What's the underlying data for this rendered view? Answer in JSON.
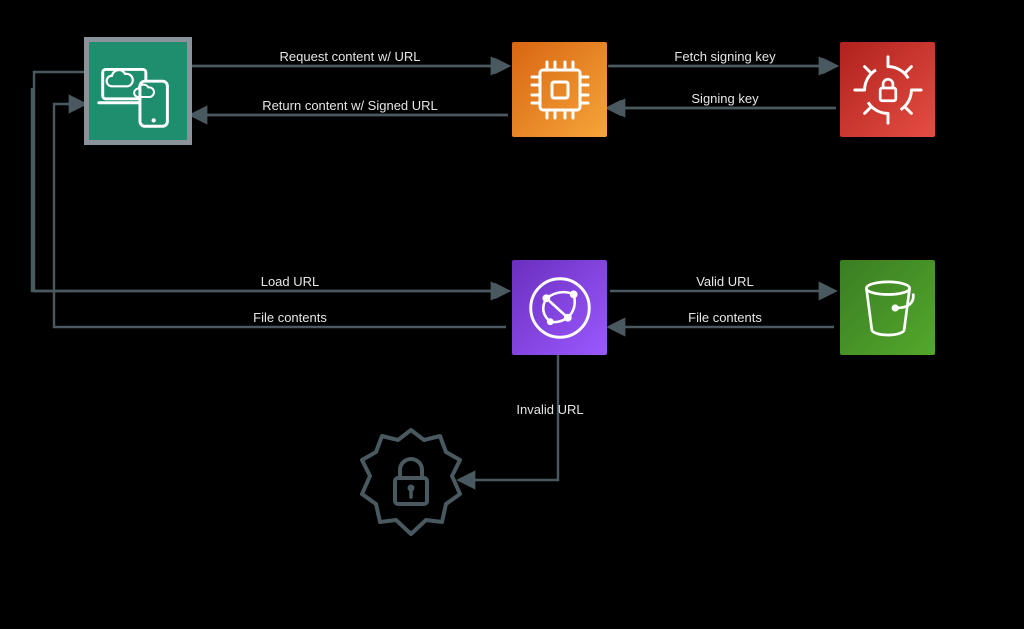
{
  "diagram": {
    "labels": {
      "top_req": "Request content w/ URL",
      "top_ret": "Return content w/ Signed URL",
      "fetch_key": "Fetch signing key",
      "signing_key": "Signing key",
      "load_url": "Load URL",
      "file_contents_left": "File contents",
      "valid_url": "Valid URL",
      "file_contents_right": "File contents",
      "invalid_url": "Invalid URL"
    },
    "nodes": {
      "client": "client-devices-icon",
      "compute": "compute-chip-icon",
      "secrets": "secrets-manager-icon",
      "cloudfront": "cloudfront-icon",
      "s3": "s3-bucket-icon",
      "shield": "access-denied-shield-icon"
    },
    "colors": {
      "client": "#1e8e6e",
      "compute_a": "#d86613",
      "compute_b": "#f6a539",
      "secrets_a": "#b0221e",
      "secrets_b": "#e54d42",
      "cloudfront_a": "#6b2fbf",
      "cloudfront_b": "#9b59ff",
      "s3_a": "#3a7d23",
      "s3_b": "#53a82c",
      "line": "#4a5860"
    }
  }
}
